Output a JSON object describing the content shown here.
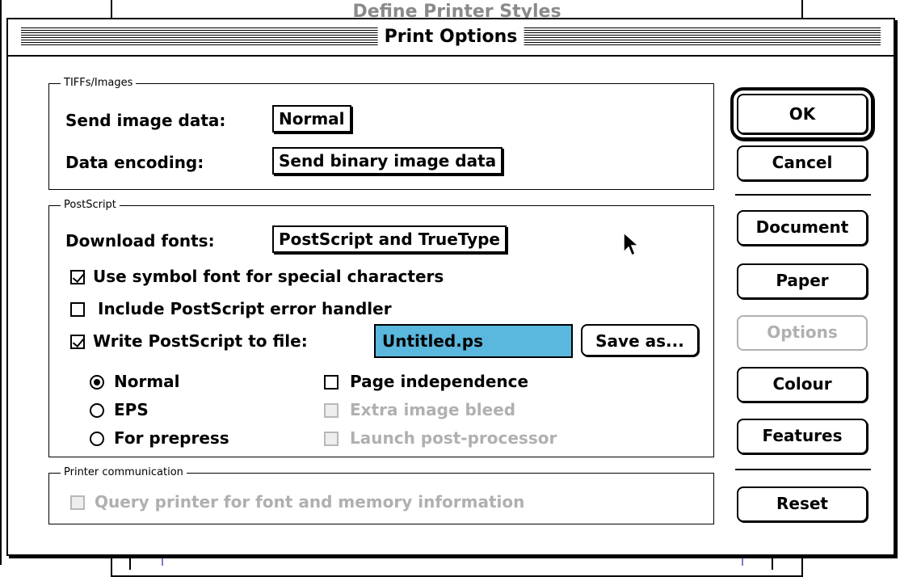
{
  "background_window": {
    "title": "Define Printer Styles"
  },
  "dialog": {
    "title": "Print Options",
    "tiffs_group": {
      "label": "TIFFs/Images",
      "send_image_data_label": "Send image data:",
      "send_image_data_value": "Normal",
      "data_encoding_label": "Data encoding:",
      "data_encoding_value": "Send binary image data"
    },
    "postscript_group": {
      "label": "PostScript",
      "download_fonts_label": "Download fonts:",
      "download_fonts_value": "PostScript and TrueType",
      "use_symbol_font": {
        "label": "Use symbol font for special characters",
        "checked": true
      },
      "include_error_handler": {
        "label": "Include PostScript error handler",
        "checked": false
      },
      "write_to_file": {
        "label": "Write PostScript to file:",
        "checked": true
      },
      "file_name": "Untitled.ps",
      "save_as_button": "Save as...",
      "radios": [
        {
          "label": "Normal",
          "selected": true
        },
        {
          "label": "EPS",
          "selected": false
        },
        {
          "label": "For prepress",
          "selected": false
        }
      ],
      "options": [
        {
          "label": "Page independence",
          "checked": false,
          "enabled": true
        },
        {
          "label": "Extra image bleed",
          "checked": false,
          "enabled": false
        },
        {
          "label": "Launch post-processor",
          "checked": false,
          "enabled": false
        }
      ]
    },
    "printer_comm_group": {
      "label": "Printer communication",
      "query_printer": {
        "label": "Query printer for font and memory information",
        "checked": false,
        "enabled": false
      }
    },
    "buttons": {
      "ok": "OK",
      "cancel": "Cancel",
      "document": "Document",
      "paper": "Paper",
      "options": "Options",
      "colour": "Colour",
      "features": "Features",
      "reset": "Reset"
    }
  },
  "colors": {
    "text_field_highlight": "#5ab7dd",
    "disabled_text": "#b0b0b0"
  }
}
